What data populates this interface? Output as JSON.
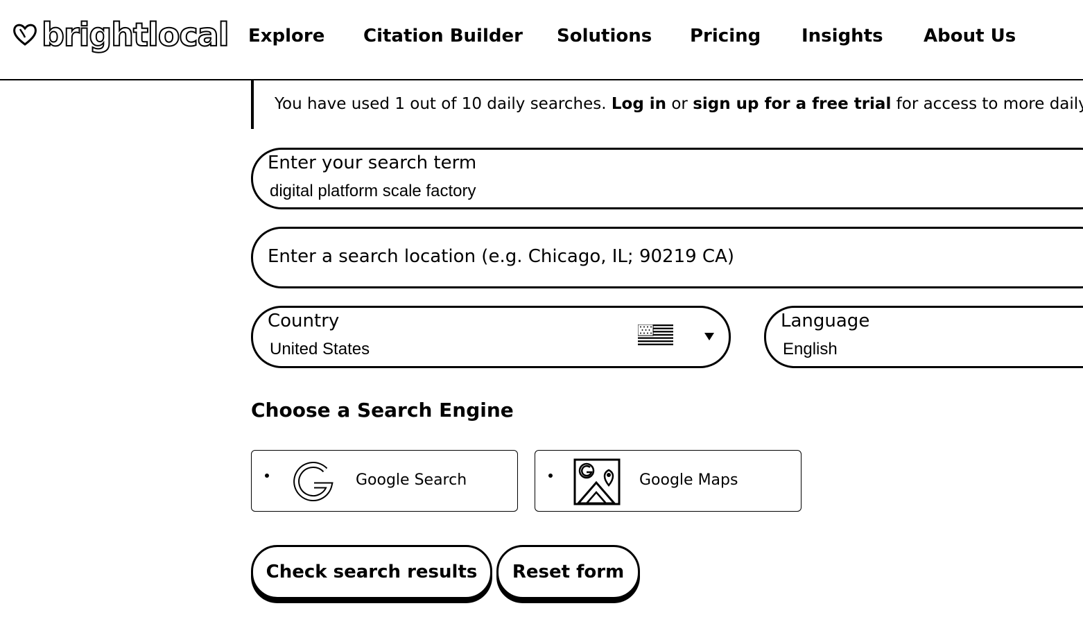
{
  "header": {
    "logo_text": "brightlocal",
    "logo_icon": "heart-icon",
    "nav": [
      {
        "label": "Explore"
      },
      {
        "label": "Citation Builder"
      },
      {
        "label": "Solutions"
      },
      {
        "label": "Pricing"
      },
      {
        "label": "Insights"
      },
      {
        "label": "About Us"
      }
    ]
  },
  "notice": {
    "prefix": "You have used 1 out of 10 daily searches. ",
    "login_link": "Log in",
    "middle": " or ",
    "signup_link": "sign up for a free trial",
    "suffix": " for access to more daily searches."
  },
  "form": {
    "search_term": {
      "label": "Enter your search term",
      "value": "digital platform scale factory"
    },
    "location": {
      "placeholder": "Enter a search location (e.g. Chicago, IL; 90219 CA)"
    },
    "country": {
      "label": "Country",
      "value": "United States",
      "flag_icon": "us-flag-icon"
    },
    "language": {
      "label": "Language",
      "value": "English"
    }
  },
  "engines": {
    "title": "Choose a Search Engine",
    "options": [
      {
        "label": "Google Search",
        "icon": "google-icon"
      },
      {
        "label": "Google Maps",
        "icon": "google-maps-icon"
      }
    ]
  },
  "actions": {
    "submit_label": "Check search results",
    "reset_label": "Reset form"
  }
}
